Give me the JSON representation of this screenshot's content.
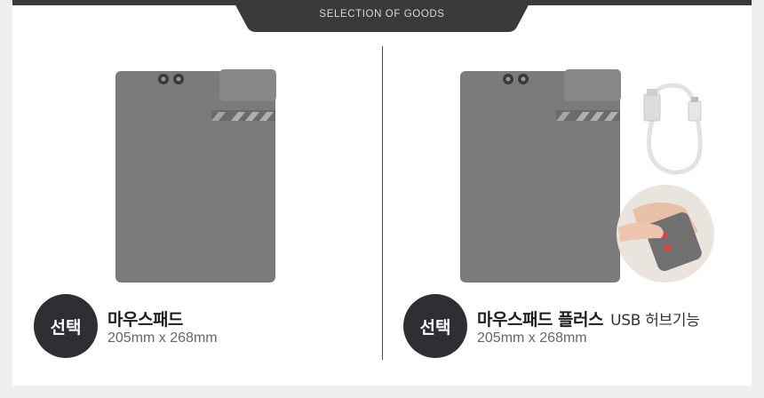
{
  "header": {
    "label": "SELECTION OF GOODS"
  },
  "products": [
    {
      "badge": "선택",
      "name": "마우스패드",
      "subtitle": "",
      "size": "205mm x 268mm"
    },
    {
      "badge": "선택",
      "name": "마우스패드 플러스",
      "subtitle": "USB 허브기능",
      "size": "205mm x 268mm"
    }
  ],
  "colors": {
    "pad": "#7b7b7b",
    "badge": "#2f2f33",
    "header": "#3a3a3d"
  }
}
